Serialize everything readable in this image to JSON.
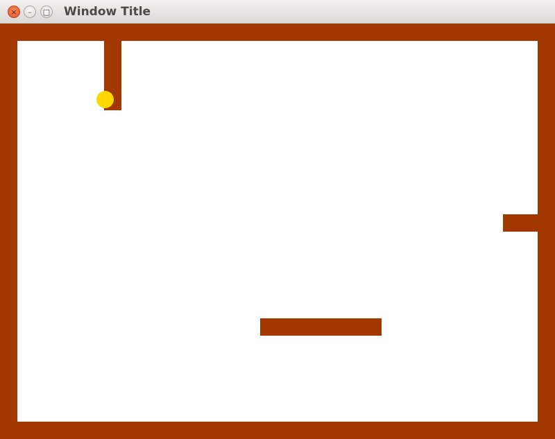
{
  "window": {
    "title": "Window Title",
    "close_glyph": "×",
    "minimize_glyph": "–",
    "maximize_glyph": "□"
  },
  "game": {
    "background_color": "#ffffff",
    "wall_color": "#a33700",
    "coin_color": "#ffd700"
  }
}
